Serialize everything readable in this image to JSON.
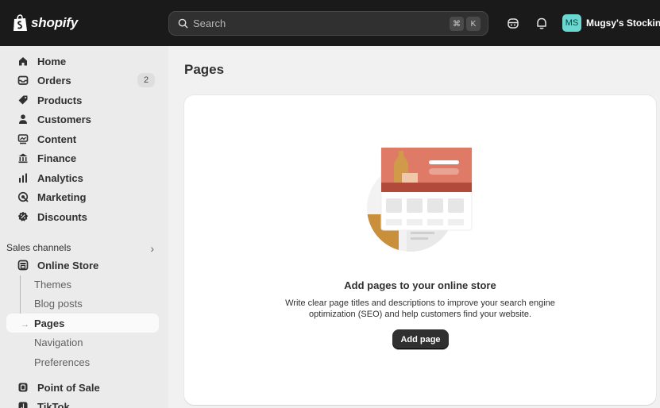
{
  "brand": {
    "name": "shopify"
  },
  "search": {
    "placeholder": "Search",
    "shortcut_cmd": "⌘",
    "shortcut_key": "K"
  },
  "store": {
    "initials": "MS",
    "name": "Mugsy's Stockings"
  },
  "sidebar": {
    "items": [
      {
        "label": "Home",
        "icon": "home-icon"
      },
      {
        "label": "Orders",
        "icon": "orders-icon",
        "badge": "2"
      },
      {
        "label": "Products",
        "icon": "tag-icon"
      },
      {
        "label": "Customers",
        "icon": "person-icon"
      },
      {
        "label": "Content",
        "icon": "content-icon"
      },
      {
        "label": "Finance",
        "icon": "bank-icon"
      },
      {
        "label": "Analytics",
        "icon": "bar-chart-icon"
      },
      {
        "label": "Marketing",
        "icon": "target-icon"
      },
      {
        "label": "Discounts",
        "icon": "discount-icon"
      }
    ],
    "sales_channels": {
      "header": "Sales channels",
      "online_store": "Online Store",
      "sub_items": [
        "Themes",
        "Blog posts",
        "Pages",
        "Navigation",
        "Preferences"
      ],
      "active_sub": "Pages",
      "more": [
        "Point of Sale",
        "TikTok"
      ]
    }
  },
  "main": {
    "title": "Pages",
    "empty_state": {
      "heading": "Add pages to your online store",
      "description": "Write clear page titles and descriptions to improve your search engine optimization (SEO) and help customers find your website.",
      "button": "Add page"
    }
  },
  "colors": {
    "topbar": "#1a1a1a",
    "sidebar": "#ebebeb",
    "canvas": "#f1f1f1",
    "accent": "#303030",
    "avatar": "#6ad7d0"
  }
}
